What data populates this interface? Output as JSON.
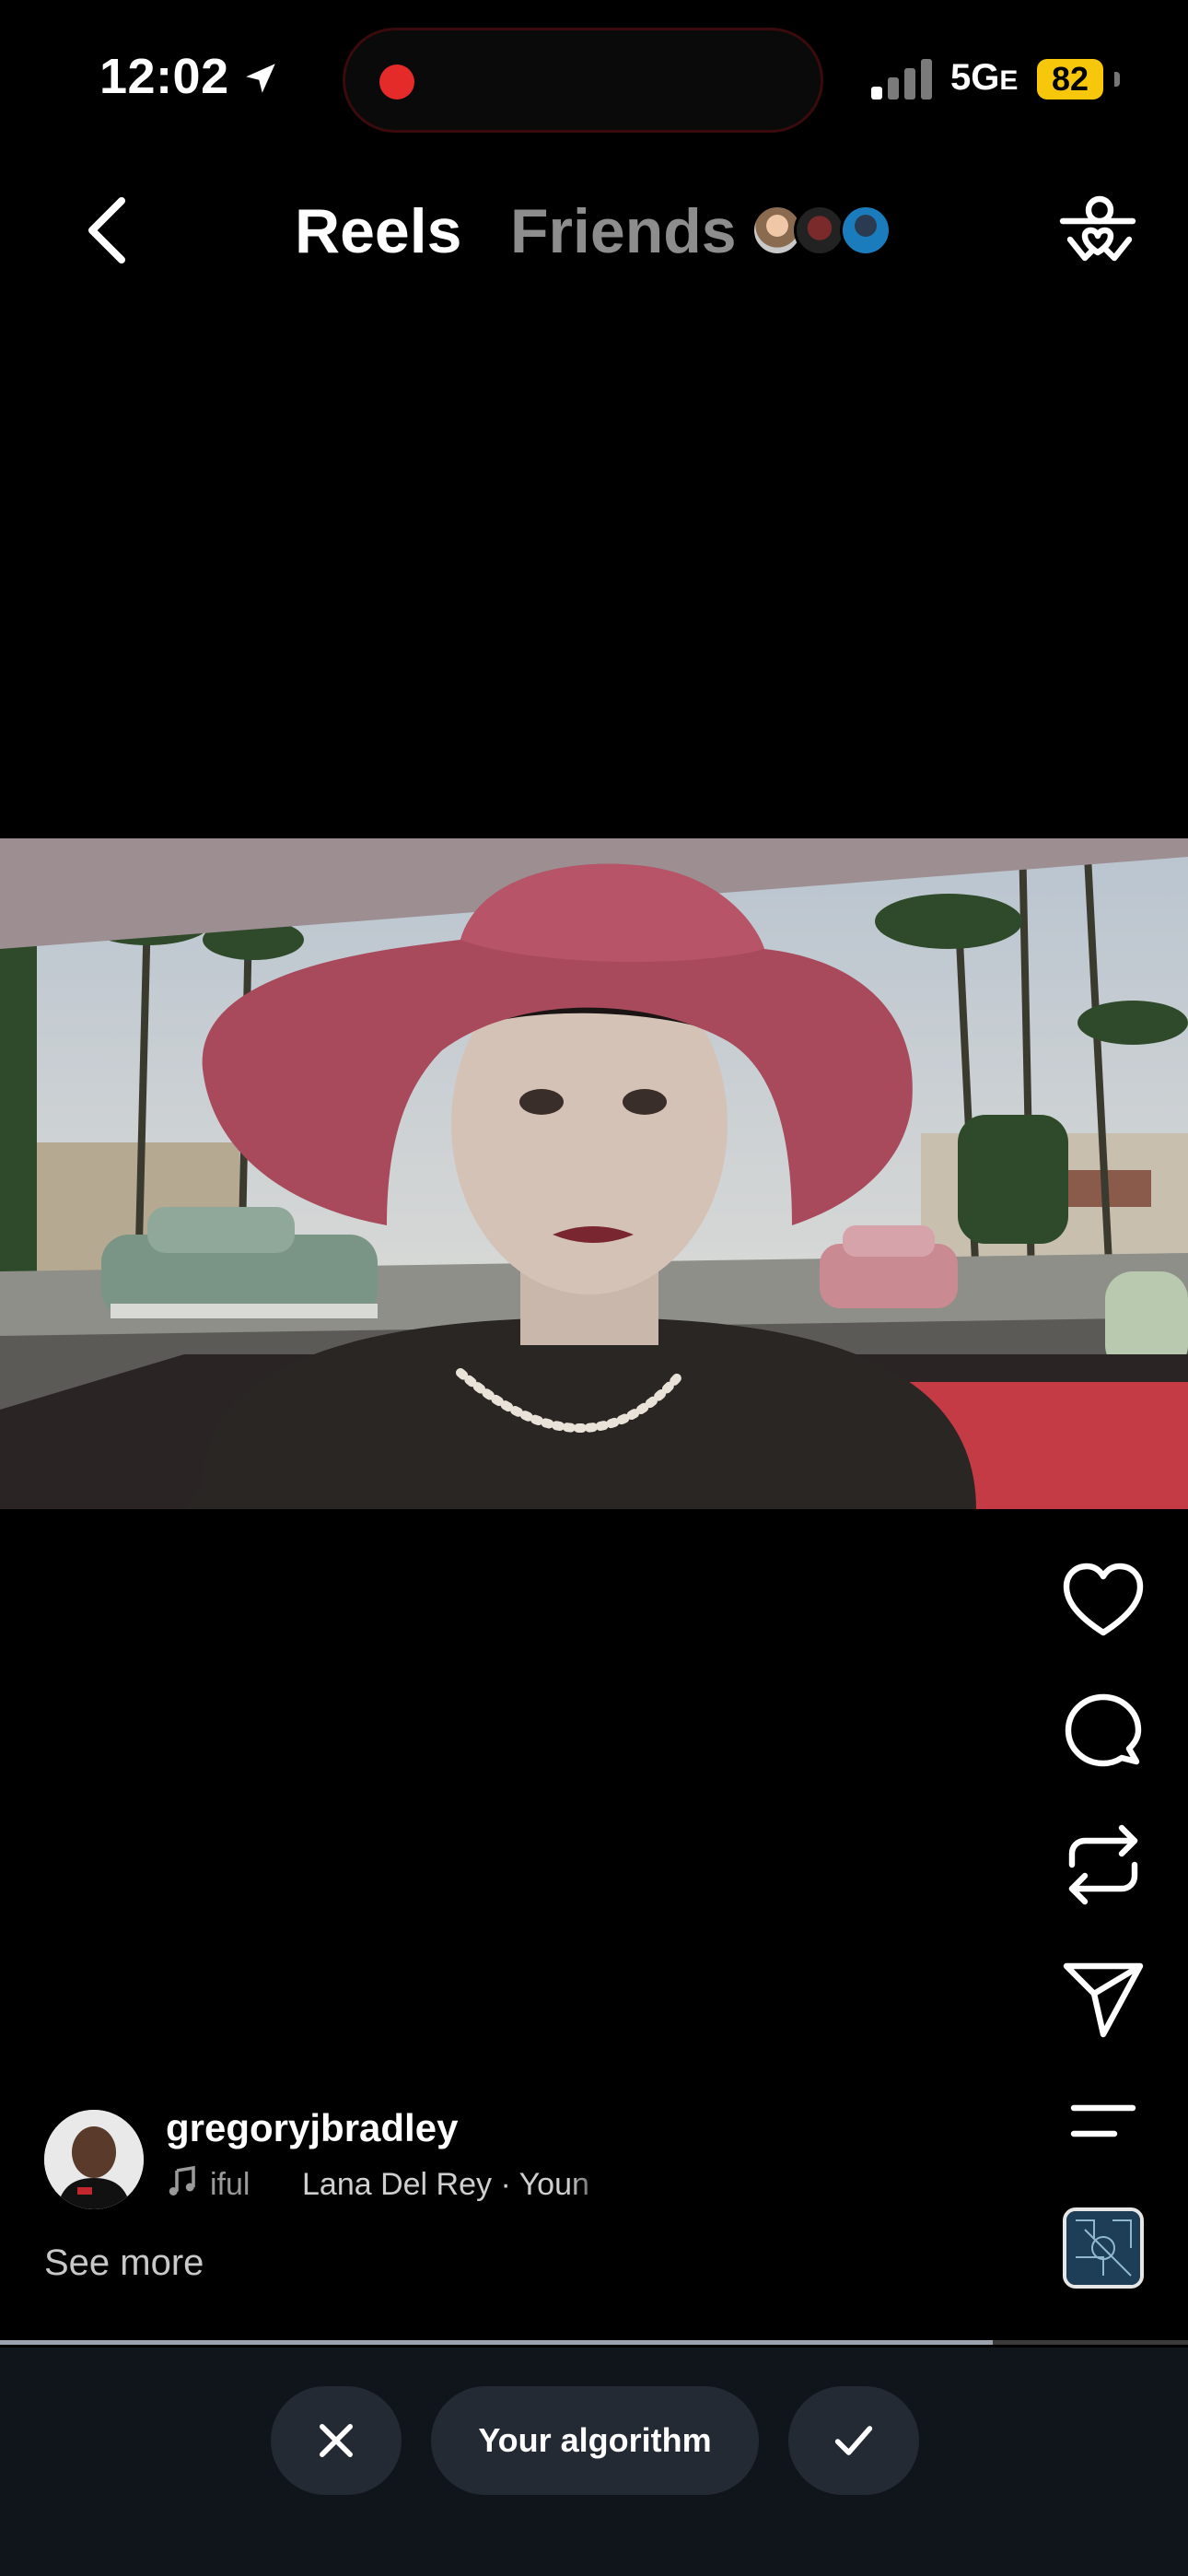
{
  "status_bar": {
    "time": "12:02",
    "network": "5G",
    "network_suffix": "E",
    "battery": "82",
    "battery_color": "#f6c70a",
    "recording_color": "#e52a2a"
  },
  "header": {
    "tabs": [
      {
        "label": "Reels",
        "active": true
      },
      {
        "label": "Friends",
        "active": false
      }
    ]
  },
  "reel": {
    "username": "gregoryjbradley",
    "audio_title": "iful",
    "audio_artist": "Lana Del Rey · Youn",
    "see_more": "See more",
    "progress": 0.836
  },
  "bottom_bar": {
    "algorithm_label": "Your algorithm"
  },
  "icons": [
    "back-icon",
    "filter-icon",
    "heart-icon",
    "comment-icon",
    "repost-icon",
    "share-icon",
    "more-icon",
    "music-note-icon",
    "close-icon",
    "check-icon"
  ]
}
